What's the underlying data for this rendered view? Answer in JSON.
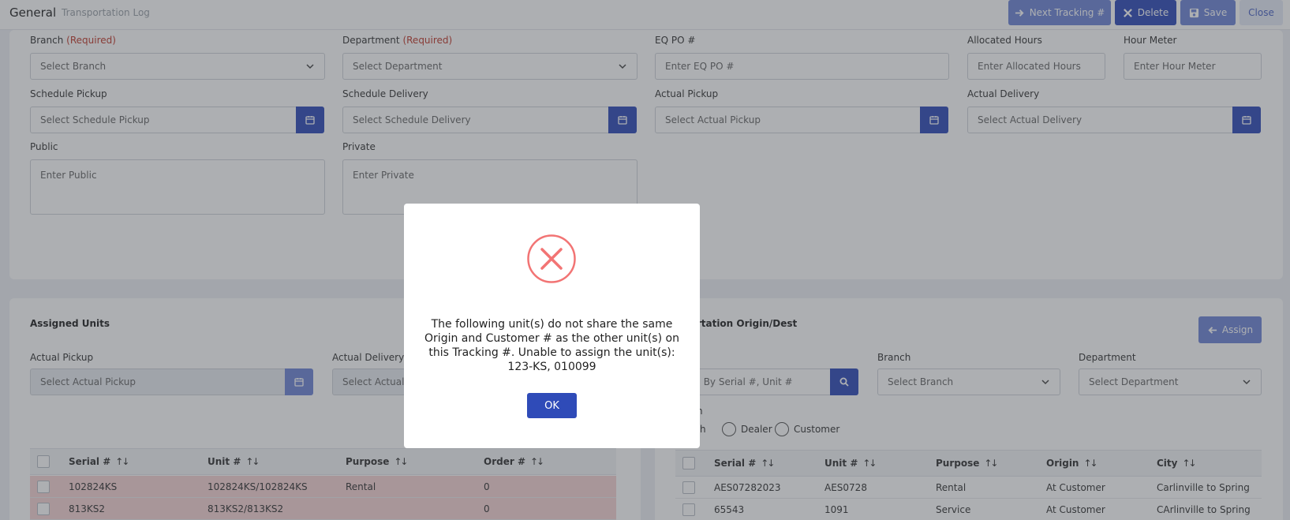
{
  "header": {
    "tab_general": "General",
    "tab_log": "Transportation Log",
    "next_label": "Next Tracking #",
    "delete_label": "Delete",
    "save_label": "Save",
    "close_label": "Close"
  },
  "form": {
    "branch_label": "Branch",
    "branch_req": "(Required)",
    "branch_value": "Select Branch",
    "department_label": "Department",
    "department_req": "(Required)",
    "department_value": "Select Department",
    "eqpo_label": "EQ PO #",
    "eqpo_placeholder": "Enter EQ PO #",
    "allocated_label": "Allocated Hours",
    "allocated_placeholder": "Enter Allocated Hours",
    "hourmeter_label": "Hour Meter",
    "hourmeter_placeholder": "Enter Hour Meter",
    "sched_pickup_label": "Schedule Pickup",
    "sched_pickup_value": "Select Schedule Pickup",
    "sched_delivery_label": "Schedule Delivery",
    "sched_delivery_value": "Select Schedule Delivery",
    "actual_pickup_label": "Actual Pickup",
    "actual_pickup_value": "Select Actual Pickup",
    "actual_delivery_label": "Actual Delivery",
    "actual_delivery_value": "Select Actual Delivery",
    "public_label": "Public",
    "public_placeholder": "Enter Public",
    "private_label": "Private",
    "private_placeholder": "Enter Private"
  },
  "assigned": {
    "title": "Assigned Units",
    "actual_pickup_label": "Actual Pickup",
    "actual_pickup_value": "Select Actual Pickup",
    "actual_delivery_label": "Actual Delivery",
    "actual_delivery_value": "Select Actual D",
    "columns": [
      "Serial #",
      "Unit #",
      "Purpose",
      "Order #"
    ],
    "sort_glyph": "↑↓",
    "rows": [
      {
        "serial": "102824KS",
        "unit": "102824KS/102824KS",
        "purpose": "Rental",
        "order": "0"
      },
      {
        "serial": "813KS2",
        "unit": "813KS2/813KS2",
        "purpose": "",
        "order": "0"
      }
    ]
  },
  "origin": {
    "title": "portation Origin/Dest",
    "assign_label": "Assign",
    "search_placeholder": "rch By Serial #, Unit #",
    "branch_label": "Branch",
    "branch_value": "Select Branch",
    "department_label": "Department",
    "department_value": "Select Department",
    "filter_label": "n",
    "radio_both": "oth",
    "radio_dealer": "Dealer",
    "radio_customer": "Customer",
    "columns": [
      "Serial #",
      "Unit #",
      "Purpose",
      "Origin",
      "City"
    ],
    "rows": [
      {
        "serial": "AES07282023",
        "unit": "AES0728",
        "purpose": "Rental",
        "origin": "At Customer",
        "city": "Carlinville to Spring"
      },
      {
        "serial": "65543",
        "unit": "1091",
        "purpose": "Service",
        "origin": "At Customer",
        "city": "CArlinville to Spring"
      }
    ]
  },
  "modal": {
    "message": "The following unit(s) do not share the same Origin and Customer # as the other unit(s) on this Tracking #. Unable to assign the unit(s): 123-KS, 010099",
    "ok_label": "OK",
    "icon": "error-x-icon",
    "icon_color": "#f27474"
  },
  "colors": {
    "primary": "#2f4bb8",
    "primary_light": "#6f86d6",
    "error_row": "#f6d4d4",
    "required": "#c0392b"
  }
}
